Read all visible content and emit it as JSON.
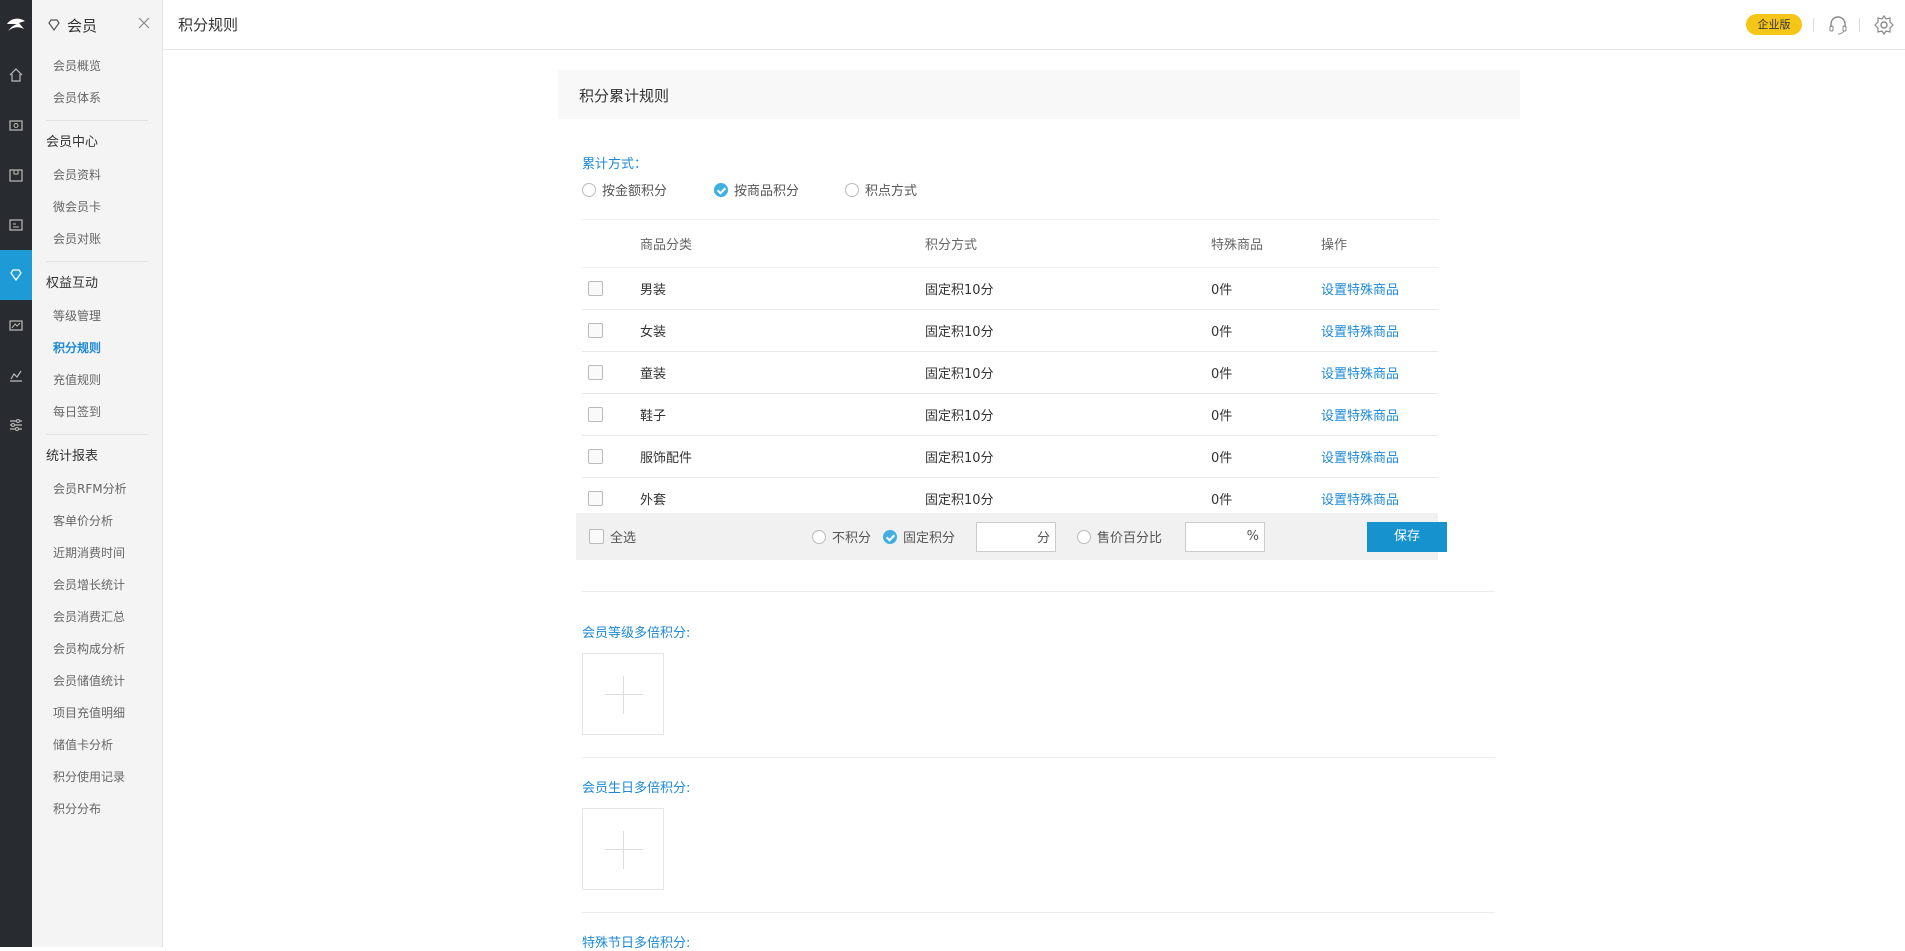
{
  "rail": {
    "icons": [
      "logo-icon",
      "home-icon",
      "cashier-icon",
      "goods-icon",
      "staff-card-icon",
      "member-icon",
      "marketing-icon",
      "report-icon",
      "settings-icon"
    ]
  },
  "sidebar": {
    "title": "会员",
    "items_top": [
      "会员概览",
      "会员体系"
    ],
    "groups": [
      {
        "title": "会员中心",
        "items": [
          "会员资料",
          "微会员卡",
          "会员对账"
        ]
      },
      {
        "title": "权益互动",
        "items": [
          "等级管理",
          "积分规则",
          "充值规则",
          "每日签到"
        ]
      },
      {
        "title": "统计报表",
        "items": [
          "会员RFM分析",
          "客单价分析",
          "近期消费时间",
          "会员增长统计",
          "会员消费汇总",
          "会员构成分析",
          "会员储值统计",
          "项目充值明细",
          "储值卡分析",
          "积分使用记录",
          "积分分布"
        ]
      }
    ],
    "active_item": "积分规则"
  },
  "topbar": {
    "page_title": "积分规则",
    "edition_badge": "企业版",
    "icons": [
      "headset-icon",
      "gear-icon"
    ]
  },
  "main": {
    "section_title": "积分累计规则",
    "accumulate_label": "累计方式：",
    "accumulate_options": [
      {
        "label": "按金额积分",
        "selected": false
      },
      {
        "label": "按商品积分",
        "selected": true
      },
      {
        "label": "积点方式",
        "selected": false
      }
    ],
    "table": {
      "headers": [
        "商品分类",
        "积分方式",
        "特殊商品",
        "操作"
      ],
      "rows": [
        {
          "category": "男装",
          "method": "固定积10分",
          "special": "0件",
          "action": "设置特殊商品"
        },
        {
          "category": "女装",
          "method": "固定积10分",
          "special": "0件",
          "action": "设置特殊商品"
        },
        {
          "category": "童装",
          "method": "固定积10分",
          "special": "0件",
          "action": "设置特殊商品"
        },
        {
          "category": "鞋子",
          "method": "固定积10分",
          "special": "0件",
          "action": "设置特殊商品"
        },
        {
          "category": "服饰配件",
          "method": "固定积10分",
          "special": "0件",
          "action": "设置特殊商品"
        },
        {
          "category": "外套",
          "method": "固定积10分",
          "special": "0件",
          "action": "设置特殊商品"
        }
      ]
    },
    "bulk": {
      "select_all": "全选",
      "no_points": "不积分",
      "fixed_points": "固定积分",
      "fixed_unit": "分",
      "percent_label": "售价百分比",
      "percent_unit": "%",
      "save": "保存",
      "fixed_selected": true
    },
    "multi_sections": [
      {
        "label": "会员等级多倍积分:"
      },
      {
        "label": "会员生日多倍积分:"
      },
      {
        "label": "特殊节日多倍积分:"
      }
    ]
  }
}
